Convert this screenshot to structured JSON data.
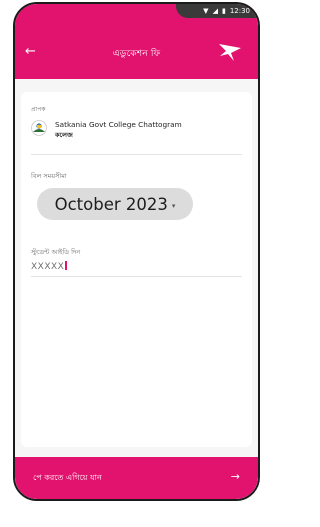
{
  "status_bar": {
    "wifi_icon": "wifi-icon",
    "signal_icon": "signal-icon",
    "battery_icon": "battery-icon",
    "time": "12:30"
  },
  "header": {
    "back_icon": "back-arrow-icon",
    "title": "এডুকেশন ফি",
    "logo_icon": "bird-logo-icon"
  },
  "receiver": {
    "label": "প্রাপক",
    "name": "Satkania Govt College Chattogram",
    "subtitle": "কলেজ"
  },
  "billing": {
    "label": "বিল সময়সীমা",
    "month": "October 2023",
    "caret": "▾"
  },
  "student": {
    "label": "স্টুডেন্ট আইডি দিন",
    "value": "XXXXX"
  },
  "footer": {
    "proceed_label": "পে করতে এগিয়ে যান",
    "arrow": "→"
  },
  "colors": {
    "accent": "#e2136e",
    "chip": "#dcdcdc",
    "background": "#f6f6f6"
  }
}
